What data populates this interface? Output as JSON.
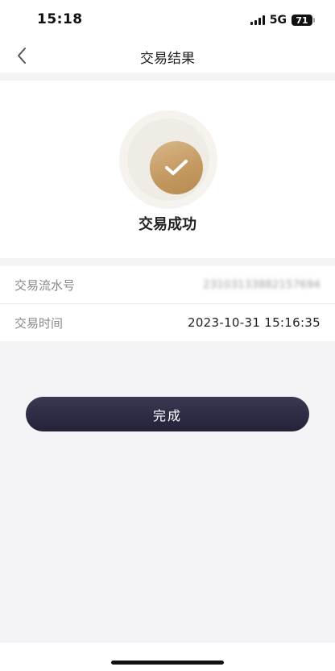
{
  "status_bar": {
    "time": "15:18",
    "network": "5G",
    "battery": "71"
  },
  "nav": {
    "title": "交易结果",
    "back_icon": "chevron-left-icon"
  },
  "result": {
    "icon": "checkmark-icon",
    "text": "交易成功",
    "accent": "#c49a62"
  },
  "details": {
    "serial_label": "交易流水号",
    "serial_value": "23103133882157694",
    "time_label": "交易时间",
    "time_value": "2023-10-31 15:16:35"
  },
  "actions": {
    "done_label": "完成",
    "done_color": "#2c2a42"
  }
}
